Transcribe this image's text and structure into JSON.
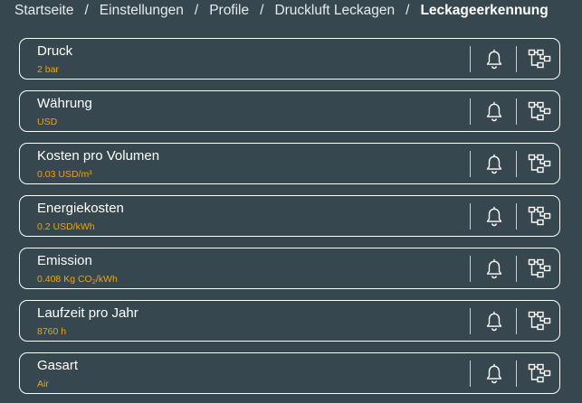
{
  "breadcrumb": [
    {
      "label": "Startseite"
    },
    {
      "label": "Einstellungen"
    },
    {
      "label": "Profile"
    },
    {
      "label": "Druckluft Leckagen"
    },
    {
      "label": "Leckageerkennung",
      "active": true
    }
  ],
  "breadcrumb_separator": "/",
  "settings": [
    {
      "id": "druck",
      "label": "Druck",
      "value": "2 bar"
    },
    {
      "id": "waehrung",
      "label": "Währung",
      "value": "USD"
    },
    {
      "id": "kosten-pro-volumen",
      "label": "Kosten pro Volumen",
      "value": "0.03 USD/m³"
    },
    {
      "id": "energiekosten",
      "label": "Energiekosten",
      "value": "0.2 USD/kWh"
    },
    {
      "id": "emission",
      "label": "Emission",
      "value_prefix": "0.408 Kg CO",
      "value_sub": "2",
      "value_suffix": "/kWh"
    },
    {
      "id": "laufzeit-pro-jahr",
      "label": "Laufzeit pro Jahr",
      "value": "8760 h"
    },
    {
      "id": "gasart",
      "label": "Gasart",
      "value": "Air"
    }
  ],
  "icons": {
    "alarm": "bell-icon",
    "hierarchy": "hierarchy-icon"
  },
  "colors": {
    "background": "#37474f",
    "text": "#ffffff",
    "value": "#f0a500",
    "border": "#ffffff"
  }
}
